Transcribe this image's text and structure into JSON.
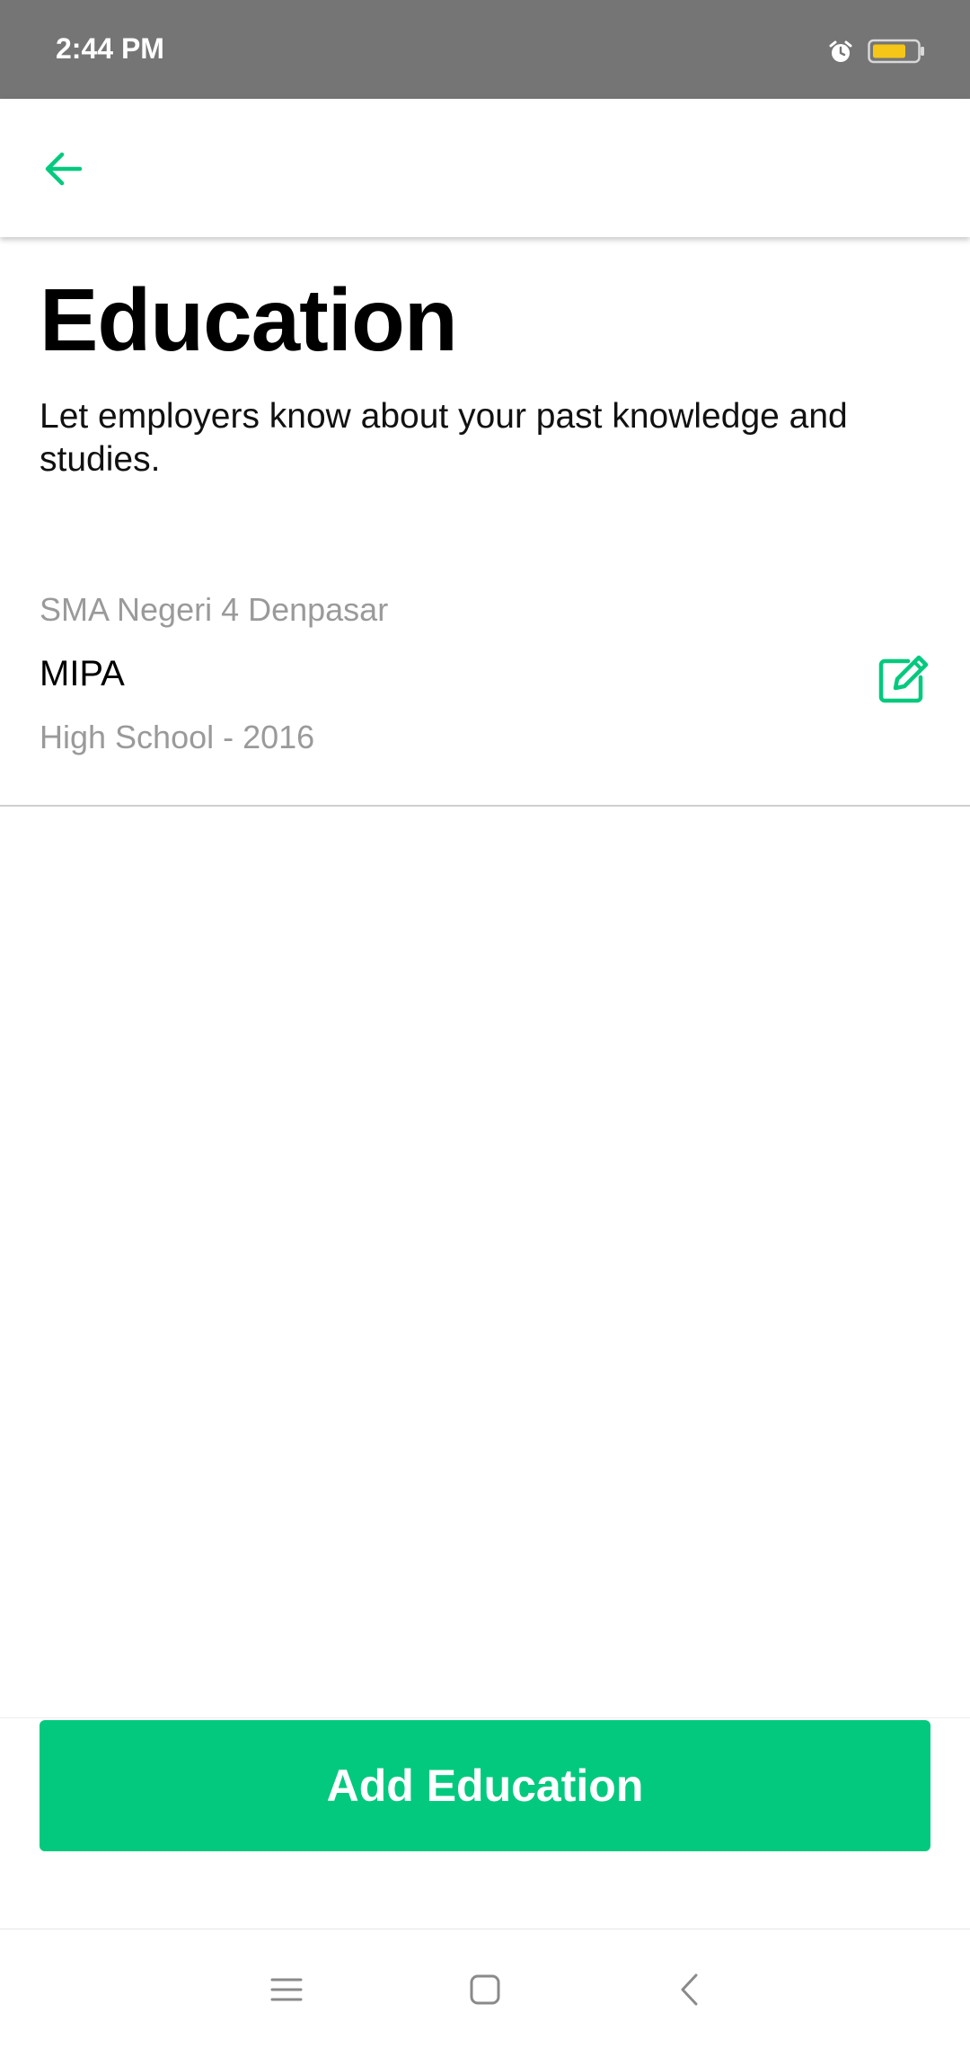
{
  "status_bar": {
    "time": "2:44 PM",
    "icons": [
      "alarm-icon",
      "battery-icon"
    ],
    "battery_color": "#f5c518"
  },
  "app_bar": {
    "back_icon": "arrow-left-icon",
    "accent_color": "#02c97e"
  },
  "header": {
    "title": "Education",
    "subtitle": "Let employers know about your past knowledge and studies."
  },
  "education": [
    {
      "school": "SMA Negeri 4 Denpasar",
      "major": "MIPA",
      "level_year": "High School - 2016",
      "edit_icon": "edit-icon"
    }
  ],
  "actions": {
    "add_label": "Add Education"
  },
  "nav_bar": {
    "icons": [
      "menu-icon",
      "home-square-icon",
      "back-chevron-icon"
    ]
  }
}
